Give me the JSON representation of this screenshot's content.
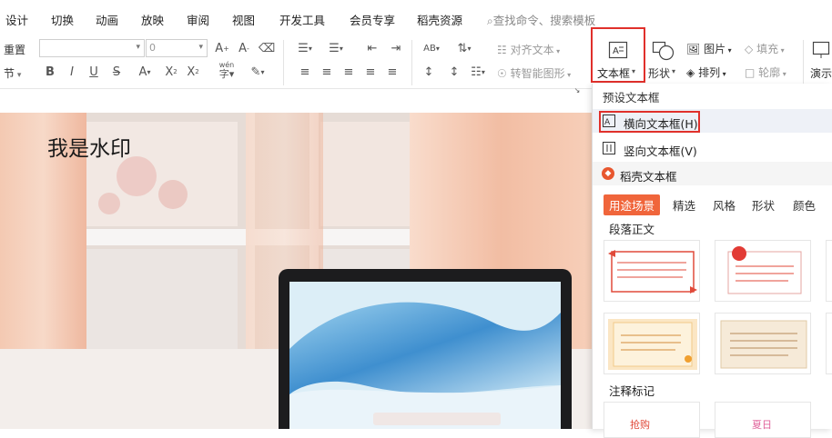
{
  "menubar": {
    "items": [
      "设计",
      "切换",
      "动画",
      "放映",
      "审阅",
      "视图",
      "开发工具",
      "会员专享",
      "稻壳资源"
    ],
    "search_placeholder": "查找命令、搜索模板"
  },
  "ribbon": {
    "reset_label": "重置",
    "section_label": "节",
    "font_size_value": "0",
    "align_text_label": "对齐文本",
    "smartart_label": "转智能图形",
    "textbox_label": "文本框",
    "shape_label": "形状",
    "picture_label": "图片",
    "arrange_label": "排列",
    "fill_label": "填充",
    "outline_label": "轮廓",
    "present_label": "演示",
    "phonetic_label": "wén"
  },
  "slide": {
    "watermark_text": "我是水印"
  },
  "dropdown": {
    "preset_header": "预设文本框",
    "horizontal_label": "横向文本框(H)",
    "vertical_label": "竖向文本框(V)",
    "docer_header": "稻壳文本框",
    "tabs": [
      "用途场景",
      "精选",
      "风格",
      "形状",
      "颜色"
    ],
    "section_paragraph": "段落正文",
    "section_annotation": "注释标记",
    "annotation_samples": [
      "抢购",
      "夏日"
    ]
  },
  "colors": {
    "accent_red": "#e0302b",
    "tab_active_bg": "#f0653b"
  }
}
